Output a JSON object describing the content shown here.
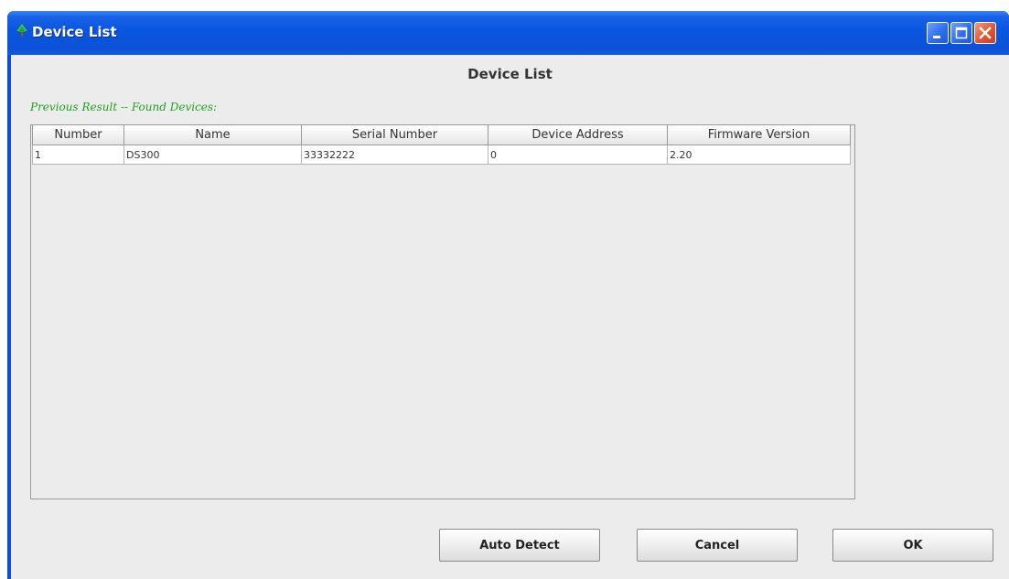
{
  "window": {
    "title": "Device List"
  },
  "dialog": {
    "heading": "Device List",
    "section_label": "Previous Result -- Found Devices:"
  },
  "table": {
    "columns": [
      "Number",
      "Name",
      "Serial Number",
      "Device Address",
      "Firmware Version"
    ],
    "rows": [
      [
        "1",
        "DS300",
        "33332222",
        "0",
        "2.20"
      ]
    ]
  },
  "buttons": {
    "auto_detect": "Auto Detect",
    "cancel": "Cancel",
    "ok": "OK"
  },
  "colors": {
    "title_bar": "#0a55e0",
    "section_label": "#1ea31e",
    "client_background": "#ececec"
  },
  "icons": {
    "app": "tree-icon",
    "minimize": "minimize-icon",
    "maximize": "maximize-icon",
    "close": "close-icon"
  }
}
